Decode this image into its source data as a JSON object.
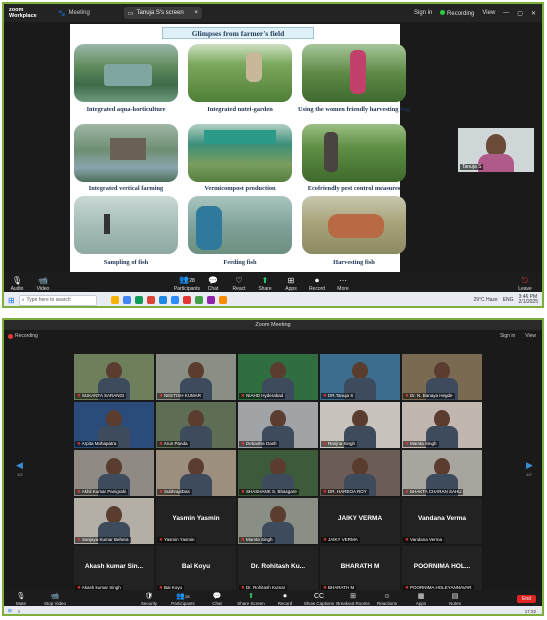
{
  "top": {
    "app_logo": [
      "zoom",
      "Workplace"
    ],
    "meeting_label": "Meeting",
    "share_tab": "Tanuja S's screen",
    "sign_in": "Sign in",
    "recording": "Recording",
    "view": "View",
    "slide": {
      "title": "Glimpses from farmer's field",
      "captions": [
        "Integrated aqua-horticulture",
        "Integrated nutri-garden",
        "Using the women friendly harvesting bag",
        "Integrated vertical farming",
        "Vermicompost production",
        "Ecofriendly pest control measures",
        "Sampling of fish",
        "Feeding fish",
        "Harvesting fish"
      ]
    },
    "self_view_name": "Tanuja S",
    "toolbar": {
      "audio": "Audio",
      "video": "Video",
      "participants": "Participants",
      "participants_count": "28",
      "chat": "Chat",
      "react": "React",
      "share": "Share",
      "apps": "Apps",
      "record": "Record",
      "more": "More",
      "leave": "Leave"
    },
    "taskbar": {
      "search_placeholder": "Type here to search",
      "weather": "29°C Haze",
      "lang": "ENG",
      "time": "3:46 PM",
      "date": "2/1/2025"
    }
  },
  "bottom": {
    "window_title": "Zoom Meeting",
    "recording": "Recording",
    "sign_in": "Sign in",
    "view": "View",
    "page_indicator_left": "1/2",
    "page_indicator_right": "1/2",
    "tiles": [
      {
        "name": "SUKANTA SARANGI"
      },
      {
        "name": "NEETISH KUMAR"
      },
      {
        "name": "NIAHD Hyderabad"
      },
      {
        "name": "DR.Tanuja S"
      },
      {
        "name": "Dr. N. Banaya Hegde"
      },
      {
        "name": "Arpita Mohapatra"
      },
      {
        "name": "Arun Panda"
      },
      {
        "name": "Debashis Dash"
      },
      {
        "name": "Ranjna Singh"
      },
      {
        "name": "Mamta Singh"
      },
      {
        "name": "Akhil Kumar Panigrahi"
      },
      {
        "name": "SubhrajitDas"
      },
      {
        "name": "SHASHANK S. Bhasgare"
      },
      {
        "name": "DR. HAREOA ROY"
      },
      {
        "name": "BHAKTA CHARAN SAHU"
      },
      {
        "name": "Sanjaya Kumar Behera"
      },
      {
        "name": "Yasmin Yasmin",
        "display": "Yasmin Yasmin"
      },
      {
        "name": "Mamta Singh"
      },
      {
        "name": "JAIKY VERMA",
        "display": "JAIKY VERMA"
      },
      {
        "name": "Vandana Verma",
        "display": "Vandana Verma"
      },
      {
        "name": "Akash kumar Singh",
        "display": "Akash kumar Sin..."
      },
      {
        "name": "Bai Koyu",
        "display": "Bai Koyu"
      },
      {
        "name": "Dr. Rohitash Kumar",
        "display": "Dr. Rohitash Ku..."
      },
      {
        "name": "BHARATH M",
        "display": "BHARATH M"
      },
      {
        "name": "POORNIMA HOLEYANNAVAR",
        "display": "POORNIMA HOL..."
      }
    ],
    "toolbar": {
      "mute": "Mute",
      "stop_video": "Stop Video",
      "security": "Security",
      "participants": "Participants",
      "participants_count": "25",
      "chat": "Chat",
      "share_screen": "Share Screen",
      "record": "Record",
      "show_captions": "Show Captions",
      "breakout_rooms": "Breakout Rooms",
      "reactions": "Reactions",
      "apps": "Apps",
      "notes": "Notes",
      "end": "End"
    },
    "taskbar_time": "17:22"
  }
}
